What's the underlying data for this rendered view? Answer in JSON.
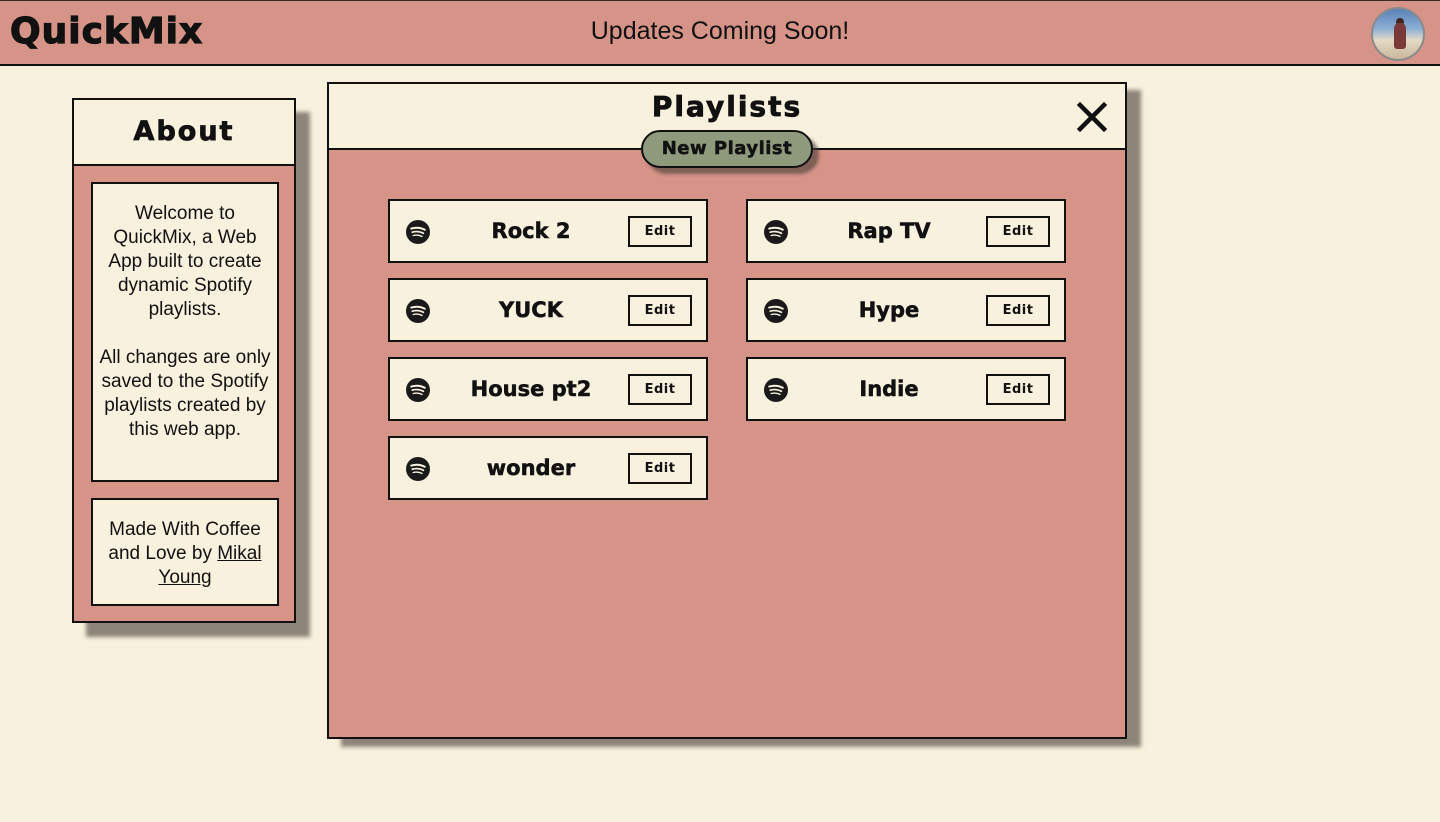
{
  "header": {
    "logo": "QuickMix",
    "message": "Updates Coming Soon!",
    "avatar_icon": "user-avatar-icon"
  },
  "about": {
    "title": "About",
    "welcome_text": "Welcome to QuickMix, a Web App built to create dynamic Spotify playlists.",
    "changes_text": "All changes are only saved to the Spotify playlists created by this web app.",
    "credits_prefix": "Made With Coffee and Love by",
    "author_link": "Mikal Young"
  },
  "playlists_panel": {
    "title": "Playlists",
    "close_icon": "close-icon",
    "new_button": "New Playlist",
    "playlists": [
      {
        "name": "Rock 2",
        "edit_label": "Edit"
      },
      {
        "name": "Rap TV",
        "edit_label": "Edit"
      },
      {
        "name": "YUCK",
        "edit_label": "Edit"
      },
      {
        "name": "Hype",
        "edit_label": "Edit"
      },
      {
        "name": "House pt2",
        "edit_label": "Edit"
      },
      {
        "name": "Indie",
        "edit_label": "Edit"
      },
      {
        "name": "wonder",
        "edit_label": "Edit"
      }
    ]
  },
  "colors": {
    "background": "#f8f1de",
    "accent": "#d69387",
    "button_green": "#8e9a7b",
    "ink": "#111111"
  }
}
